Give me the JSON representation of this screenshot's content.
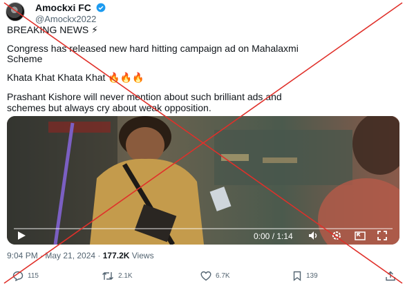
{
  "author": {
    "name": "Amockxi FC",
    "handle": "@Amockx2022"
  },
  "tweet": {
    "lines": [
      "BREAKING NEWS ⚡",
      "Congress has released new hard hitting campaign ad on Mahalaxmi",
      "Scheme",
      "Khata Khat Khata Khat 🔥🔥🔥",
      "Prashant Kishore will never mention about such brilliant ads and",
      "schemes but always cry about weak opposition."
    ]
  },
  "video": {
    "time": "0:00 / 1:14"
  },
  "meta": {
    "time": "9:04 PM · May 21, 2024 · ",
    "views_count": "177.2K",
    "views_label": " Views"
  },
  "actions": {
    "replies": "115",
    "reposts": "2.1K",
    "likes": "6.7K",
    "bookmarks": "139"
  },
  "colors": {
    "cross": "#e0302a",
    "verified": "#1d9bf0"
  }
}
